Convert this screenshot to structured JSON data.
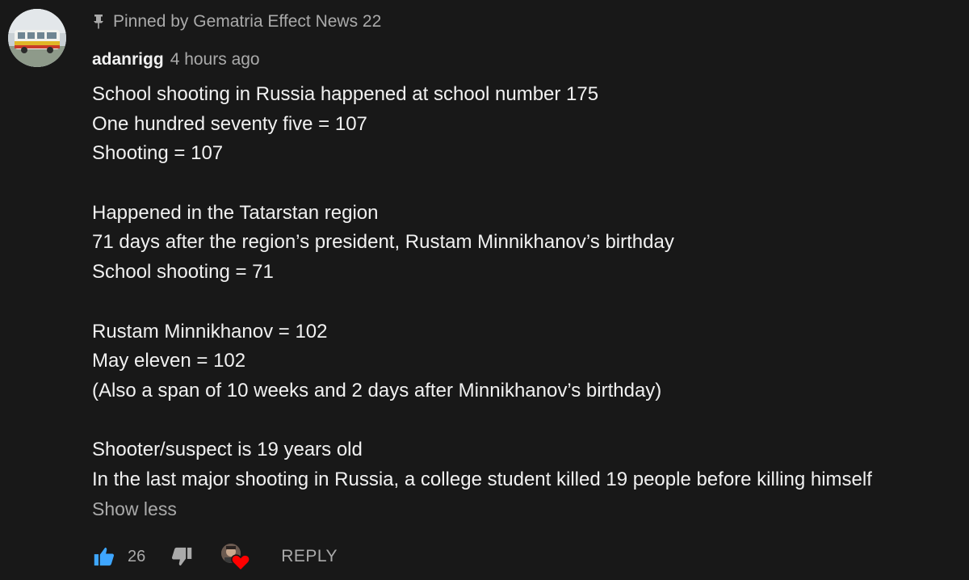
{
  "comment": {
    "pinned_text": "Pinned by Gematria Effect News 22",
    "author": "adanrigg",
    "timestamp": "4 hours ago",
    "lines": [
      "School shooting in Russia happened at school number 175",
      "One hundred seventy five = 107",
      "Shooting = 107",
      "",
      "Happened in the Tatarstan region",
      "71 days after the region’s president, Rustam Minnikhanov’s birthday",
      "School shooting = 71",
      "",
      "Rustam Minnikhanov = 102",
      "May eleven = 102",
      "(Also a span of 10 weeks and 2 days after Minnikhanov’s birthday)",
      "",
      "Shooter/suspect is 19 years old",
      "In the last major shooting in Russia, a college student killed 19 people before killing himself"
    ],
    "show_less_label": "Show less",
    "like_count": "26",
    "reply_label": "REPLY"
  },
  "colors": {
    "background": "#181818",
    "primary_text": "#f1f1f1",
    "secondary_text": "#aaaaaa",
    "like_active": "#3ea6ff",
    "heart": "#ff0000"
  },
  "icons": {
    "pin": "pin-icon",
    "like": "thumbs-up-icon",
    "dislike": "thumbs-down-icon",
    "heart": "creator-heart-icon"
  }
}
